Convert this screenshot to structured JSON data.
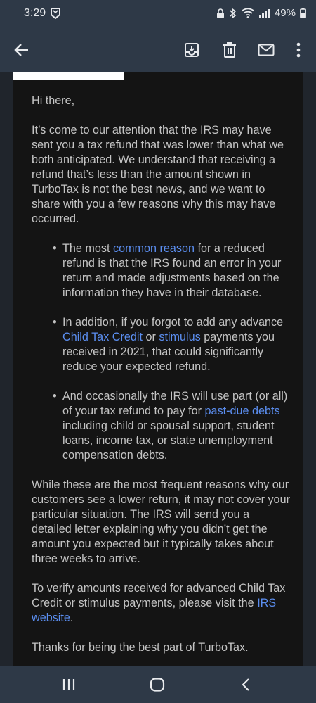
{
  "status_bar": {
    "time": "3:29",
    "battery": "49%"
  },
  "toolbar": {
    "icons": [
      "back-arrow-icon",
      "archive-icon",
      "delete-icon",
      "mark-unread-icon",
      "more-vert-icon"
    ]
  },
  "email": {
    "greeting": "Hi there,",
    "intro": "It’s come to our attention that the IRS may have sent you a tax refund that was lower than what we both anticipated. We understand that receiving a refund that’s less than the amount shown in TurboTax is not the best news, and we want to share with you a few reasons why this may have occurred.",
    "bullets": {
      "b1": {
        "t1": "The most ",
        "link1": "common reason",
        "t2": " for a reduced refund is that the IRS found an error in your return and made adjustments based on the information they have in their database."
      },
      "b2": {
        "t1": "In addition, if you forgot to add any advance ",
        "link1": "Child Tax Credit",
        "t2": " or ",
        "link2": "stimulus",
        "t3": " payments you received in 2021, that could significantly reduce your expected refund."
      },
      "b3": {
        "t1": "And occasionally the IRS will use part (or all) of your tax refund to pay for ",
        "link1": "past-due debts",
        "t2": " including child or spousal support, student loans, income tax, or state unemployment compensation debts."
      }
    },
    "para2": "While these are the most frequent reasons why our customers see a lower return, it may not cover your particular situation. The IRS will send you a detailed letter explaining why you didn’t get the amount you expected but it typically takes about three weeks to arrive.",
    "para3_text": "To verify amounts received for advanced Child Tax Credit or stimulus payments, please visit the ",
    "para3_link": "IRS website",
    "para3_end": ".",
    "closing": "Thanks for being the best part of TurboTax."
  },
  "nav": {
    "icons": [
      "recents-icon",
      "home-icon",
      "back-icon"
    ]
  },
  "colors": {
    "bar": "#2e3947",
    "body": "#141414",
    "link": "#5b8ef0",
    "text": "#c4c4c4"
  }
}
